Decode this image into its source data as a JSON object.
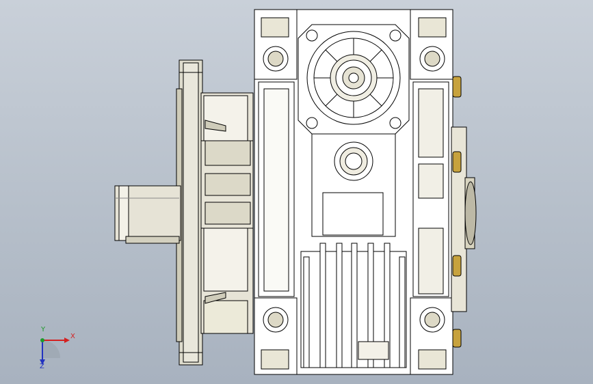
{
  "viewport": {
    "background_top": "#c9d0d9",
    "background_bottom": "#a8b2bf",
    "model_stroke": "#000000",
    "model_fill": "#ffffff",
    "shade_fill": "#d9d6c6",
    "brass_fill": "#c7a23d"
  },
  "triad": {
    "x_label": "X",
    "y_label": "Y",
    "z_label": "Z",
    "x_color": "#d42020",
    "y_color": "#1f9a2a",
    "z_color": "#2233c0"
  }
}
